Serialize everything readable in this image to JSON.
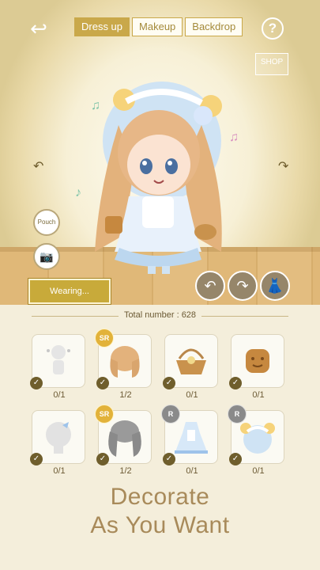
{
  "header": {
    "tabs": [
      {
        "label": "Dress up",
        "active": true
      },
      {
        "label": "Makeup",
        "active": false
      },
      {
        "label": "Backdrop",
        "active": false
      }
    ],
    "help_label": "?",
    "shop_label": "SHOP"
  },
  "stage": {
    "pouch_label": "Pouch",
    "wearing_label": "Wearing..."
  },
  "inventory": {
    "total_label": "Total number : 628",
    "items": [
      {
        "name": "face-item",
        "rarity": "",
        "count": "0/1"
      },
      {
        "name": "hair-item",
        "rarity": "SR",
        "count": "1/2"
      },
      {
        "name": "basket-item",
        "rarity": "",
        "count": "0/1"
      },
      {
        "name": "biscuit-item",
        "rarity": "",
        "count": "0/1"
      },
      {
        "name": "head-item",
        "rarity": "",
        "count": "0/1"
      },
      {
        "name": "hair-gray-item",
        "rarity": "SR",
        "count": "1/2"
      },
      {
        "name": "dress-item",
        "rarity": "R",
        "count": "0/1"
      },
      {
        "name": "headband-item",
        "rarity": "R",
        "count": "0/1"
      }
    ]
  },
  "slogan": {
    "line1": "Decorate",
    "line2": "As You Want"
  },
  "colors": {
    "accent": "#c8aa3a",
    "background": "#f4eedb",
    "text": "#6c5a34"
  }
}
